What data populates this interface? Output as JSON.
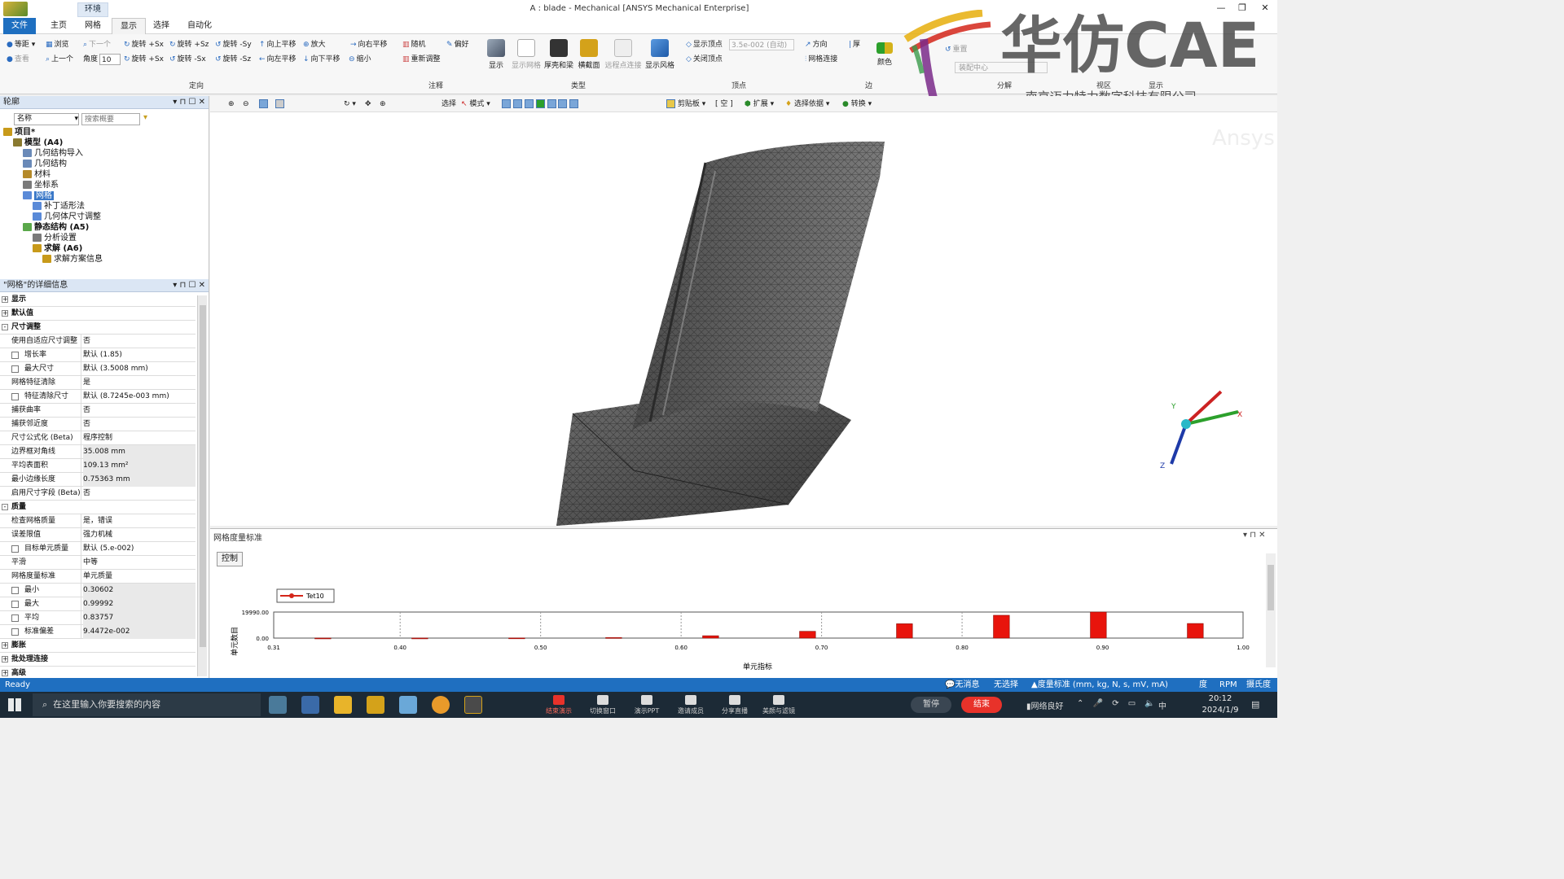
{
  "window": {
    "title": "A : blade - Mechanical [ANSYS Mechanical Enterprise]",
    "context_tab": "环境"
  },
  "menu": [
    "文件",
    "主页",
    "网格",
    "显示",
    "选择",
    "自动化"
  ],
  "ribbon": {
    "orient": [
      "等距",
      "浏览",
      "下一个",
      "旋转 +Sx",
      "旋转 +Sz",
      "旋转 -Sy",
      "向上平移",
      "放大",
      "向右平移",
      "查看",
      "上一个",
      "角度",
      "10",
      "旋转 +Sx",
      "旋转 -Sx",
      "旋转 -Sz",
      "向左平移",
      "向下平移",
      "缩小"
    ],
    "annot": [
      "随机",
      "偏好",
      "重新调整"
    ],
    "type": [
      "显示",
      "显示网格",
      "厚壳和梁",
      "横截面",
      "远程点连接",
      "显示风格"
    ],
    "vertex": [
      "显示顶点",
      "3.5e-002 (自动)",
      "关闭顶点"
    ],
    "edge": [
      "方向",
      "厚",
      "网格连接",
      "颜色"
    ],
    "explode": [
      "重置",
      "装配中心"
    ],
    "groups": [
      "定向",
      "注释",
      "类型",
      "顶点",
      "边",
      "分解",
      "视区",
      "显示"
    ]
  },
  "toolbar2": [
    "选择",
    "模式",
    "剪贴板",
    "[ 空 ]",
    "扩展",
    "选择依据",
    "转换"
  ],
  "outline": {
    "title": "轮廓",
    "filter_label": "名称",
    "search_placeholder": "搜索概要",
    "nodes": [
      {
        "label": "项目*",
        "level": 0,
        "bold": true,
        "color": "#c89a1a"
      },
      {
        "label": "模型 (A4)",
        "level": 1,
        "bold": true,
        "color": "#8a7a30"
      },
      {
        "label": "几何结构导入",
        "level": 2,
        "color": "#6a8ab8"
      },
      {
        "label": "几何结构",
        "level": 2,
        "color": "#6a8ab8"
      },
      {
        "label": "材料",
        "level": 2,
        "color": "#b58a2a"
      },
      {
        "label": "坐标系",
        "level": 2,
        "color": "#7a7a7a"
      },
      {
        "label": "网格",
        "level": 2,
        "color": "#5a8ad8",
        "selected": true
      },
      {
        "label": "补丁适形法",
        "level": 3,
        "color": "#5a8ad8"
      },
      {
        "label": "几何体尺寸调整",
        "level": 3,
        "color": "#5a8ad8"
      },
      {
        "label": "静态结构 (A5)",
        "level": 2,
        "bold": true,
        "color": "#5aa84a"
      },
      {
        "label": "分析设置",
        "level": 3,
        "color": "#7a7a7a"
      },
      {
        "label": "求解 (A6)",
        "level": 3,
        "bold": true,
        "color": "#c89a1a"
      },
      {
        "label": "求解方案信息",
        "level": 4,
        "color": "#c89a1a"
      }
    ]
  },
  "details": {
    "title": "\"网格\"的详细信息",
    "rows": [
      {
        "type": "cat",
        "k": "显示",
        "exp": "+"
      },
      {
        "type": "cat",
        "k": "默认值",
        "exp": "+"
      },
      {
        "type": "cat",
        "k": "尺寸调整",
        "exp": "-"
      },
      {
        "k": "使用自适应尺寸调整",
        "v": "否"
      },
      {
        "k": "增长率",
        "v": "默认 (1.85)",
        "cb": true
      },
      {
        "k": "最大尺寸",
        "v": "默认 (3.5008 mm)",
        "cb": true
      },
      {
        "k": "网格特征清除",
        "v": "是"
      },
      {
        "k": "特征清除尺寸",
        "v": "默认 (8.7245e-003 mm)",
        "cb": true
      },
      {
        "k": "捕获曲率",
        "v": "否"
      },
      {
        "k": "捕获邻近度",
        "v": "否"
      },
      {
        "k": "尺寸公式化 (Beta)",
        "v": "程序控制"
      },
      {
        "k": "边界框对角线",
        "v": "35.008 mm",
        "shade": true
      },
      {
        "k": "平均表面积",
        "v": "109.13 mm²",
        "shade": true
      },
      {
        "k": "最小边缘长度",
        "v": "0.75363 mm",
        "shade": true
      },
      {
        "k": "启用尺寸字段 (Beta)",
        "v": "否"
      },
      {
        "type": "cat",
        "k": "质量",
        "exp": "-"
      },
      {
        "k": "检查网格质量",
        "v": "是，错误"
      },
      {
        "k": "误差限值",
        "v": "强力机械"
      },
      {
        "k": "目标单元质量",
        "v": "默认 (5.e-002)",
        "cb": true
      },
      {
        "k": "平滑",
        "v": "中等"
      },
      {
        "k": "网格度量标准",
        "v": "单元质量"
      },
      {
        "k": "最小",
        "v": "0.30602",
        "cb": true,
        "shade": true
      },
      {
        "k": "最大",
        "v": "0.99992",
        "cb": true,
        "shade": true
      },
      {
        "k": "平均",
        "v": "0.83757",
        "cb": true,
        "shade": true
      },
      {
        "k": "标准偏差",
        "v": "9.4472e-002",
        "cb": true,
        "shade": true
      },
      {
        "type": "cat",
        "k": "膨胀",
        "exp": "+"
      },
      {
        "type": "cat",
        "k": "批处理连接",
        "exp": "+"
      },
      {
        "type": "cat",
        "k": "高级",
        "exp": "+"
      }
    ]
  },
  "viewport": {
    "watermark": "Ansys",
    "triad": [
      "Y",
      "X",
      "Z"
    ]
  },
  "overlay": {
    "brand": "华仿CAE",
    "company": "南京迈力特力数字科技有限公司"
  },
  "chart_data": {
    "type": "bar",
    "title": "网格度量标准",
    "control_button": "控制",
    "legend": "Tet10",
    "xlabel": "单元指标",
    "ylabel": "单元数目",
    "xlim": [
      0.31,
      1.0
    ],
    "ylim": [
      0,
      19990
    ],
    "y_ticks": [
      "19990.00",
      "0.00"
    ],
    "x_ticks": [
      "0.31",
      "0.40",
      "0.50",
      "0.60",
      "0.70",
      "0.80",
      "0.90",
      "1.00"
    ],
    "bars": [
      {
        "x": 0.345,
        "y": 40
      },
      {
        "x": 0.414,
        "y": 60
      },
      {
        "x": 0.483,
        "y": 120
      },
      {
        "x": 0.552,
        "y": 400
      },
      {
        "x": 0.621,
        "y": 1800
      },
      {
        "x": 0.69,
        "y": 5200
      },
      {
        "x": 0.759,
        "y": 11000
      },
      {
        "x": 0.828,
        "y": 17500
      },
      {
        "x": 0.897,
        "y": 19990
      },
      {
        "x": 0.966,
        "y": 11200
      }
    ],
    "bar_color": "#e8140c"
  },
  "status": {
    "ready": "Ready",
    "items": [
      "无消息",
      "无选择",
      "度量标准 (mm, kg, N, s, mV, mA)",
      "度",
      "RPM",
      "摄氏度"
    ]
  },
  "taskbar": {
    "search_placeholder": "在这里输入你要搜索的内容",
    "apps": [
      "结束演示",
      "切换窗口",
      "演示PPT",
      "邀请成员",
      "分享直播",
      "美颜与滤镜"
    ],
    "pause": "暂停",
    "end": "结束",
    "network": "网络良好",
    "ime": "中",
    "time": "20:12",
    "date": "2024/1/9"
  }
}
